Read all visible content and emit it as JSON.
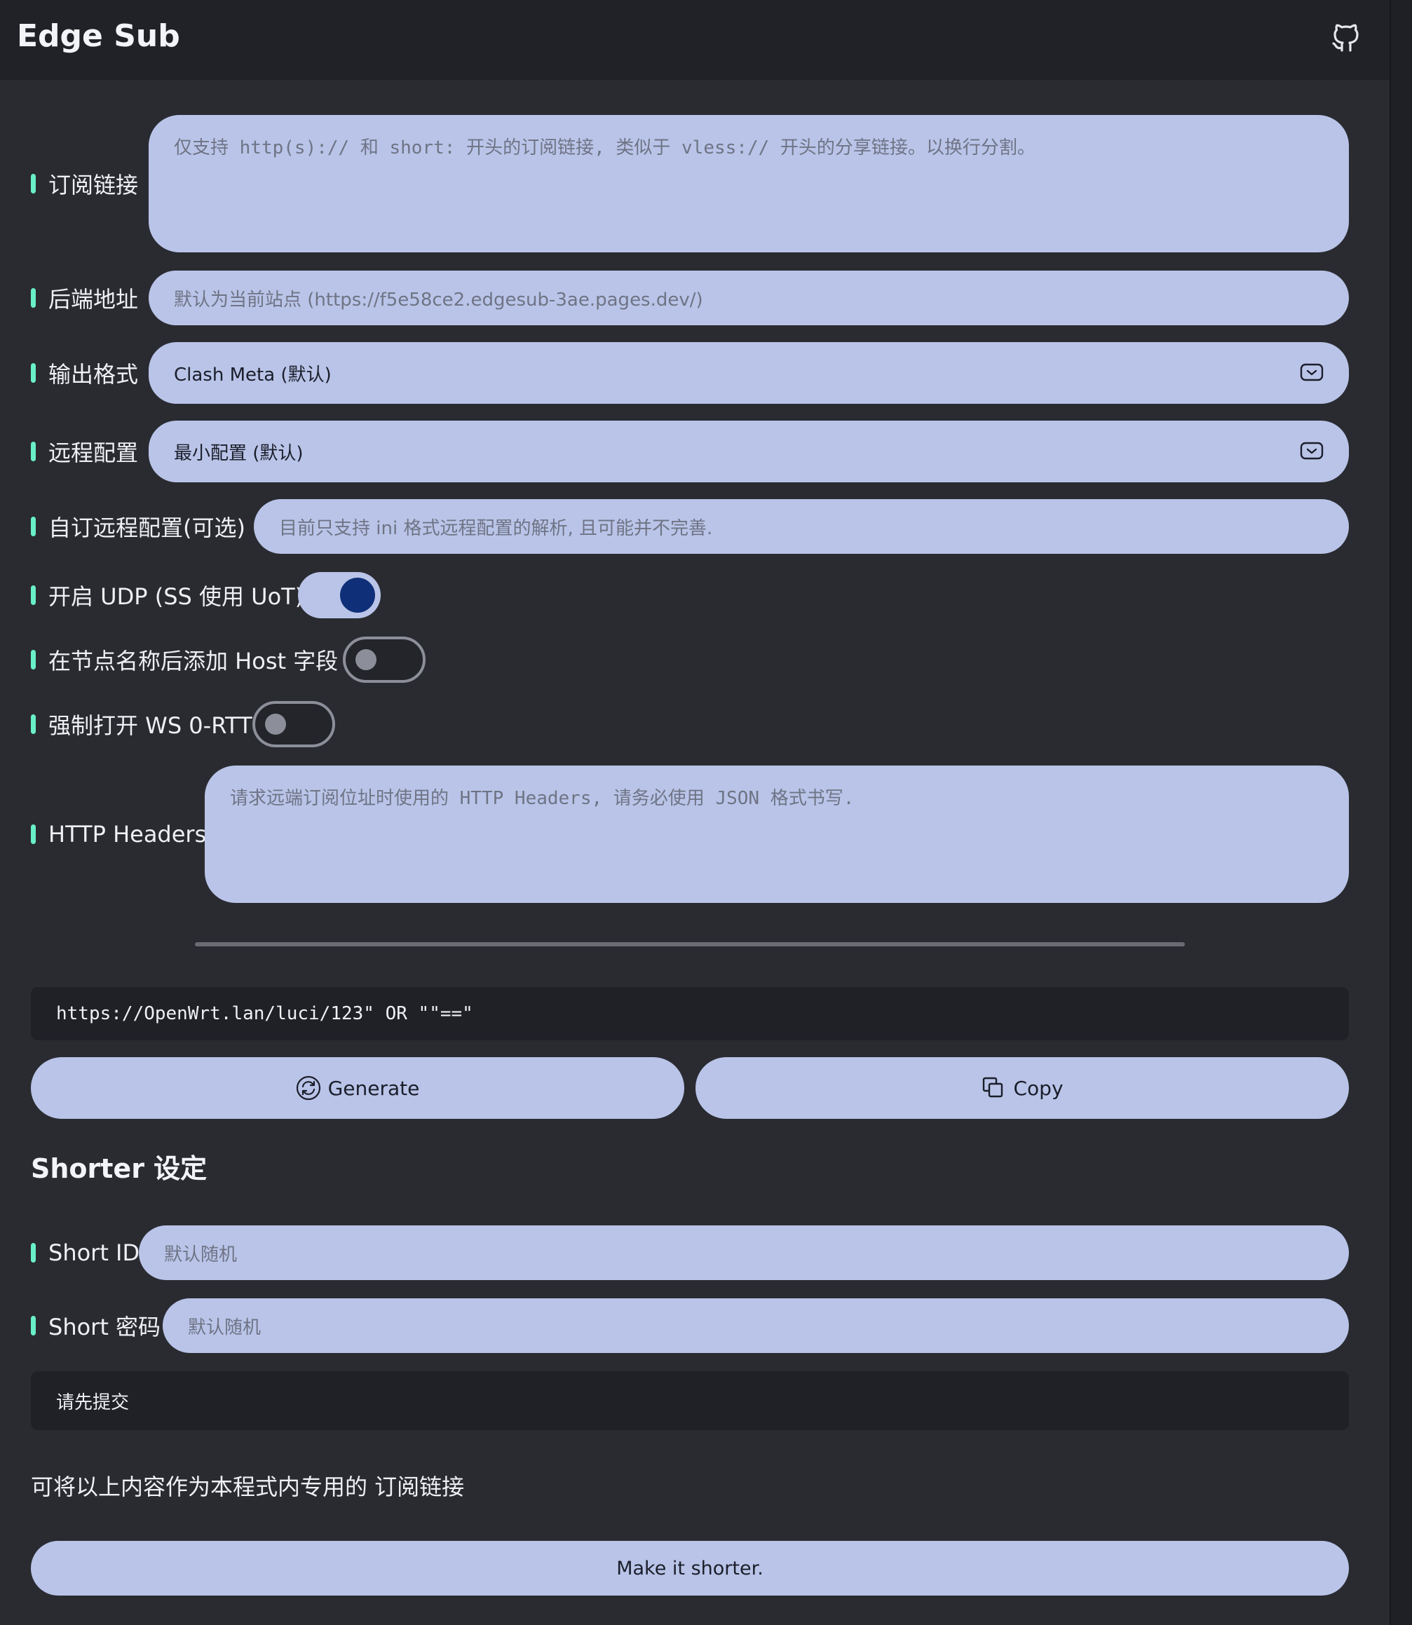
{
  "app": {
    "title": "Edge Sub"
  },
  "form": {
    "subscription": {
      "label": "订阅链接",
      "placeholder": "仅支持 http(s):// 和 short: 开头的订阅链接, 类似于 vless:// 开头的分享链接。以换行分割。"
    },
    "backend": {
      "label": "后端地址",
      "placeholder": "默认为当前站点 (https://f5e58ce2.edgesub-3ae.pages.dev/)"
    },
    "output_format": {
      "label": "输出格式",
      "value": "Clash Meta (默认)"
    },
    "remote_config": {
      "label": "远程配置",
      "value": "最小配置 (默认)"
    },
    "custom_remote": {
      "label": "自订远程配置(可选)",
      "placeholder": "目前只支持 ini 格式远程配置的解析, 且可能并不完善."
    },
    "udp": {
      "label": "开启 UDP (SS 使用 UoT)",
      "enabled": true
    },
    "host_field": {
      "label": "在节点名称后添加 Host 字段",
      "enabled": false
    },
    "ws_0rtt": {
      "label": "强制打开 WS 0-RTT",
      "enabled": false
    },
    "http_headers": {
      "label": "HTTP Headers",
      "placeholder": "请求远端订阅位址时使用的 HTTP Headers, 请务必使用 JSON 格式书写."
    }
  },
  "output": {
    "url": "https://OpenWrt.lan/luci/123\" OR \"\"==\"",
    "generate_label": "Generate",
    "copy_label": "Copy"
  },
  "shorter": {
    "title": "Shorter 设定",
    "short_id": {
      "label": "Short ID",
      "placeholder": "默认随机"
    },
    "short_password": {
      "label": "Short 密码",
      "placeholder": "默认随机"
    },
    "status": "请先提交",
    "hint": "可将以上内容作为本程式内专用的 订阅链接",
    "button_label": "Make it shorter."
  },
  "colors": {
    "accent": "#69f0c9",
    "field": "#b9c4e8",
    "toggle_knob_on": "#0f2f78",
    "background": "#2a2b31"
  }
}
